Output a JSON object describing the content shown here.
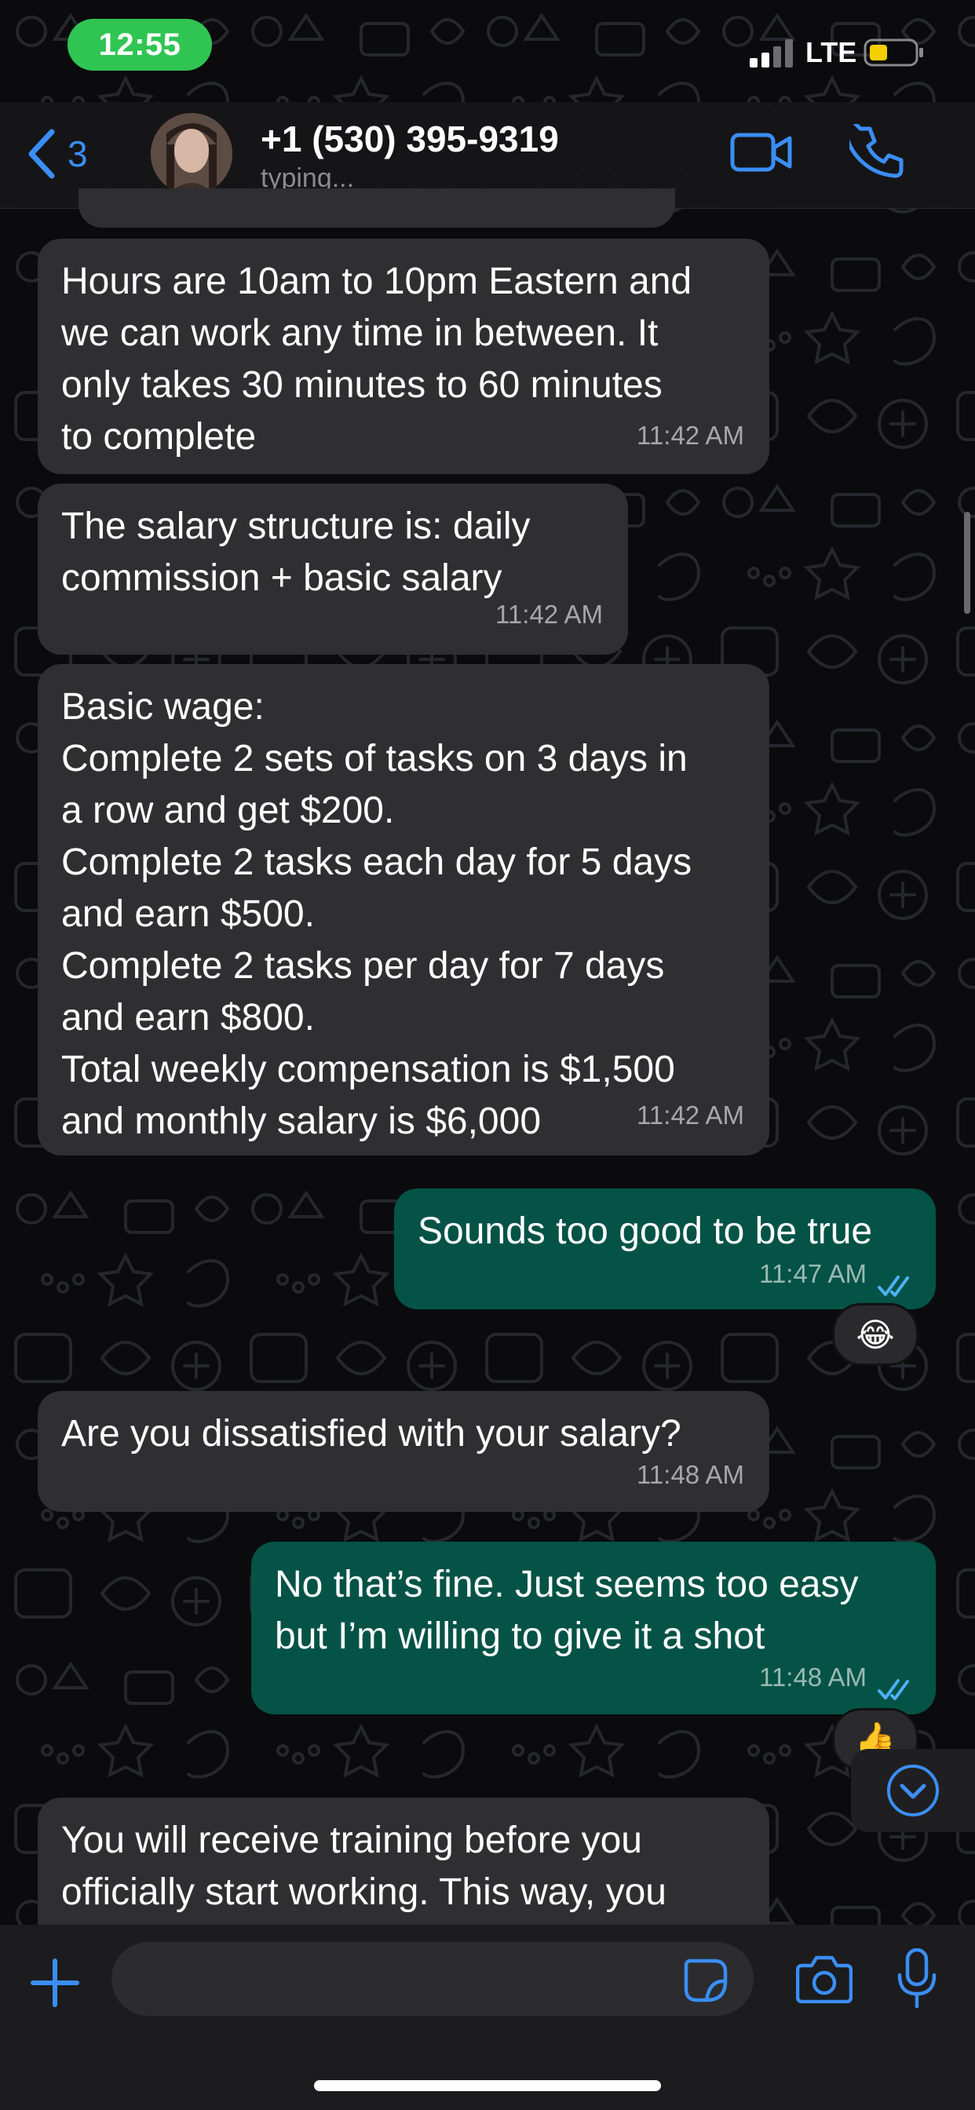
{
  "status_bar": {
    "time": "12:55",
    "network": "LTE"
  },
  "header": {
    "back_count": "3",
    "contact_name": "+1 (530) 395-9319",
    "contact_status": "typing..."
  },
  "messages": [
    {
      "direction": "in",
      "text": "Hours are 10am to 10pm Eastern and\nwe can work any time in between. It\nonly takes 30 minutes to 60 minutes\nto complete",
      "time": "11:42 AM"
    },
    {
      "direction": "in",
      "text": "The salary structure is: daily\ncommission + basic salary",
      "time": "11:42 AM"
    },
    {
      "direction": "in",
      "text": "Basic wage:\nComplete 2 sets of tasks on 3 days in\na row and get $200.\nComplete 2 tasks each day for 5 days\nand earn $500.\nComplete 2 tasks per day for 7 days\nand earn $800.\nTotal weekly compensation is $1,500\nand monthly salary is $6,000",
      "time": "11:42 AM"
    },
    {
      "direction": "out",
      "text": "Sounds too good to be true",
      "time": "11:47 AM",
      "reaction": "😂"
    },
    {
      "direction": "in",
      "text": "Are you dissatisfied with your salary?",
      "time": "11:48 AM"
    },
    {
      "direction": "out",
      "text": "No that’s fine. Just seems too easy\nbut I’m willing to give it a shot",
      "time": "11:48 AM",
      "reaction": "👍"
    },
    {
      "direction": "in",
      "text": "You will receive training before you\nofficially start working. This way, you",
      "time": ""
    }
  ],
  "icons": {
    "back": "chevron-left-icon",
    "video": "video-camera-icon",
    "call": "phone-icon",
    "plus": "plus-icon",
    "sticker": "sticker-icon",
    "camera": "camera-icon",
    "mic": "microphone-icon",
    "scroll_down": "chevron-down-icon",
    "read_receipt": "double-check-icon"
  },
  "colors": {
    "accent": "#3a8ef5",
    "outgoing_bubble": "#045346",
    "incoming_bubble": "#2f2f31",
    "time_pill": "#30c553",
    "battery_low": "#f5d000"
  }
}
